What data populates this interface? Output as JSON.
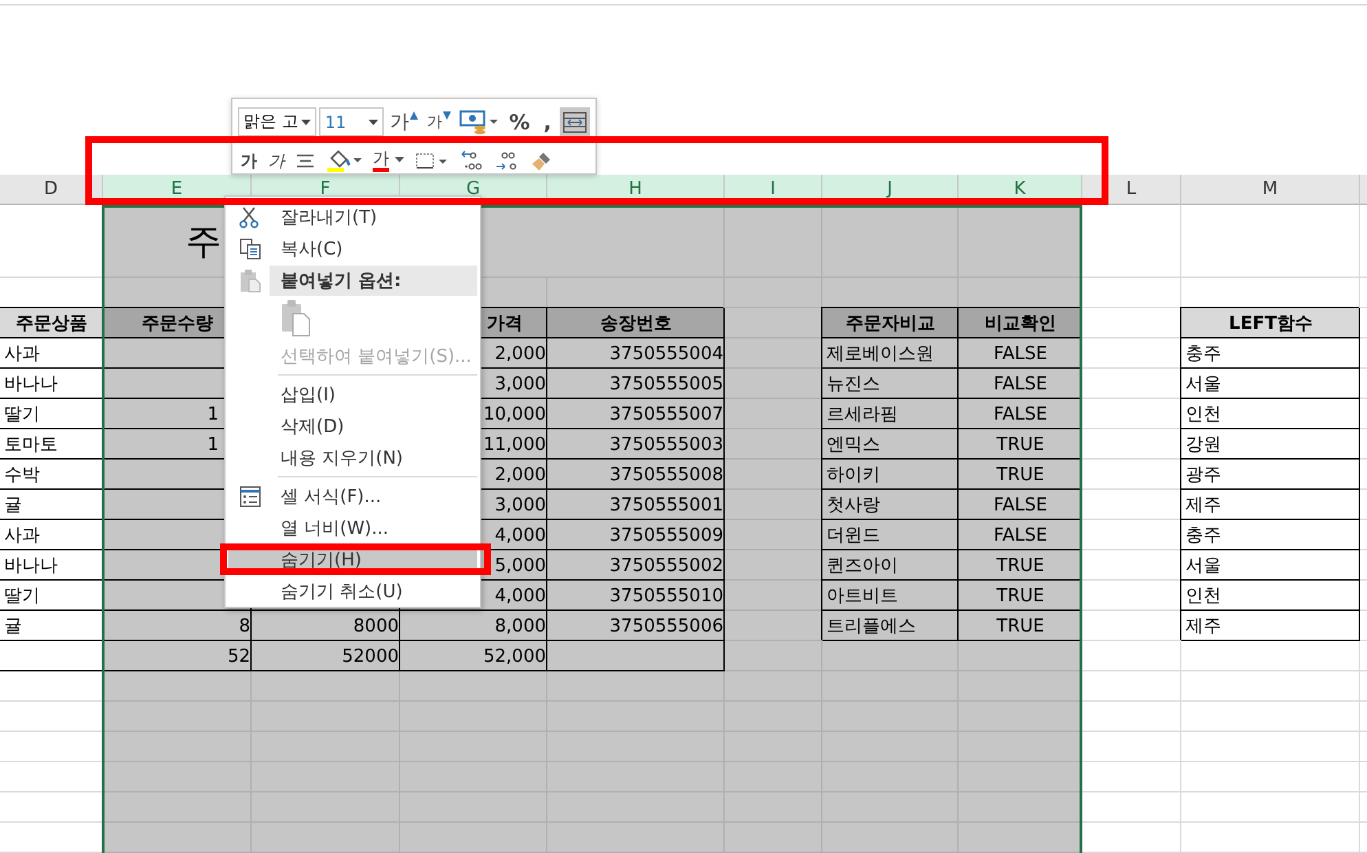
{
  "mini_toolbar": {
    "font": "맑은 고",
    "size": "11",
    "row1": [
      {
        "kind": "grow-font",
        "label": "가",
        "on": false
      },
      {
        "kind": "shrink-font",
        "label": "가",
        "on": false
      },
      {
        "kind": "accounting",
        "on": false
      },
      {
        "kind": "text",
        "label": "%",
        "on": false
      },
      {
        "kind": "text",
        "label": ",",
        "on": false
      },
      {
        "kind": "wrap",
        "on": true
      }
    ],
    "row2": [
      {
        "kind": "bold",
        "label": "가",
        "on": false
      },
      {
        "kind": "italic",
        "label": "가",
        "on": false
      },
      {
        "kind": "center",
        "on": false
      },
      {
        "kind": "fill-color",
        "color": "#ffff00",
        "on": false
      },
      {
        "kind": "font-color",
        "label": "가",
        "color": "#ff0000",
        "on": false
      },
      {
        "kind": "borders",
        "on": false
      },
      {
        "kind": "increase-decimal",
        "on": false
      },
      {
        "kind": "decrease-decimal",
        "on": false
      },
      {
        "kind": "format-painter",
        "on": false
      }
    ]
  },
  "sheet": {
    "columns": [
      {
        "label": "D",
        "selected": false
      },
      {
        "label": "E",
        "selected": true
      },
      {
        "label": "F",
        "selected": true
      },
      {
        "label": "G",
        "selected": true
      },
      {
        "label": "H",
        "selected": true
      },
      {
        "label": "I",
        "selected": true
      },
      {
        "label": "J",
        "selected": true
      },
      {
        "label": "K",
        "selected": true
      },
      {
        "label": "L",
        "selected": false
      },
      {
        "label": "M",
        "selected": false
      }
    ],
    "title": "주",
    "rows": [
      {
        "kind": "header",
        "D": "주문상품",
        "E": "주문수량",
        "G": "가격",
        "H": "송장번호",
        "J": "주문자비교",
        "K": "비교확인",
        "M": "LEFT함수"
      },
      {
        "kind": "data",
        "D": "사과",
        "G": "2,000",
        "H": "3750555004",
        "J": "제로베이스원",
        "K": "FALSE",
        "M": "충주"
      },
      {
        "kind": "data",
        "D": "바나나",
        "G": "3,000",
        "H": "3750555005",
        "J": "뉴진스",
        "K": "FALSE",
        "M": "서울"
      },
      {
        "kind": "data",
        "D": "딸기",
        "E": "1",
        "G": "10,000",
        "H": "3750555007",
        "J": "르세라핌",
        "K": "FALSE",
        "M": "인천"
      },
      {
        "kind": "data",
        "D": "토마토",
        "E": "1",
        "G": "11,000",
        "H": "3750555003",
        "J": "엔믹스",
        "K": "TRUE",
        "M": "강원"
      },
      {
        "kind": "data",
        "D": "수박",
        "G": "2,000",
        "H": "3750555008",
        "J": "하이키",
        "K": "TRUE",
        "M": "광주"
      },
      {
        "kind": "data",
        "D": "귤",
        "G": "3,000",
        "H": "3750555001",
        "J": "첫사랑",
        "K": "FALSE",
        "M": "제주"
      },
      {
        "kind": "data",
        "D": "사과",
        "G": "4,000",
        "H": "3750555009",
        "J": "더윈드",
        "K": "FALSE",
        "M": "충주"
      },
      {
        "kind": "data",
        "D": "바나나",
        "G": "5,000",
        "H": "3750555002",
        "J": "퀸즈아이",
        "K": "TRUE",
        "M": "서울"
      },
      {
        "kind": "data",
        "D": "딸기",
        "G": "4,000",
        "H": "3750555010",
        "J": "아트비트",
        "K": "TRUE",
        "M": "인천"
      },
      {
        "kind": "data",
        "D": "귤",
        "E": "8",
        "F": "8000",
        "G": "8,000",
        "H": "3750555006",
        "J": "트리플에스",
        "K": "TRUE",
        "M": "제주"
      },
      {
        "kind": "total",
        "E": "52",
        "F": "52000",
        "G": "52,000"
      }
    ]
  },
  "context_menu": {
    "items": [
      {
        "kind": "cut",
        "label": "잘라내기(T)",
        "disabled": false,
        "selected": false
      },
      {
        "kind": "copy",
        "label": "복사(C)",
        "disabled": false,
        "selected": false
      },
      {
        "kind": "paste-header",
        "label": "붙여넣기 옵션:",
        "disabled": false,
        "selected": false
      },
      {
        "kind": "paste-options"
      },
      {
        "kind": "item",
        "label": "선택하여 붙여넣기(S)...",
        "disabled": true,
        "selected": false
      },
      {
        "kind": "separator"
      },
      {
        "kind": "item",
        "label": "삽입(I)",
        "disabled": false,
        "selected": false
      },
      {
        "kind": "item",
        "label": "삭제(D)",
        "disabled": false,
        "selected": false
      },
      {
        "kind": "item",
        "label": "내용 지우기(N)",
        "disabled": false,
        "selected": false
      },
      {
        "kind": "separator"
      },
      {
        "kind": "format",
        "label": "셀 서식(F)...",
        "disabled": false,
        "selected": false
      },
      {
        "kind": "item",
        "label": "열 너비(W)...",
        "disabled": false,
        "selected": false
      },
      {
        "kind": "item",
        "label": "숨기기(H)",
        "disabled": false,
        "selected": true
      },
      {
        "kind": "item",
        "label": "숨기기 취소(U)",
        "disabled": false,
        "selected": false
      }
    ]
  }
}
